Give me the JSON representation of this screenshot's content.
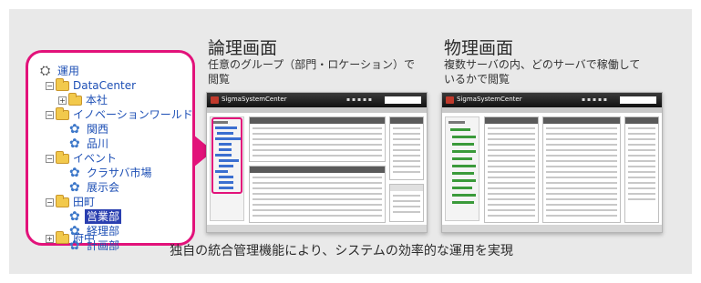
{
  "tree": {
    "items": [
      {
        "label": "運用",
        "type": "root"
      },
      {
        "label": "DataCenter",
        "type": "folder"
      },
      {
        "label": "本社",
        "type": "folder"
      },
      {
        "label": "イノベーションワールド",
        "type": "folder"
      },
      {
        "label": "関西",
        "type": "group"
      },
      {
        "label": "品川",
        "type": "group"
      },
      {
        "label": "イベント",
        "type": "folder"
      },
      {
        "label": "クラサバ市場",
        "type": "group"
      },
      {
        "label": "展示会",
        "type": "group"
      },
      {
        "label": "田町",
        "type": "folder"
      },
      {
        "label": "営業部",
        "type": "group",
        "selected": true
      },
      {
        "label": "経理部",
        "type": "group"
      },
      {
        "label": "計画部",
        "type": "group"
      },
      {
        "label": "府中",
        "type": "folder"
      }
    ]
  },
  "logical": {
    "title": "論理画面",
    "desc_line1": "任意のグループ（部門・ロケーション）で",
    "desc_line2": "閲覧"
  },
  "physical": {
    "title": "物理画面",
    "desc_line1": "複数サーバの内、どのサーバで稼働して",
    "desc_line2": "いるかで閲覧"
  },
  "shot_app_name": "SigmaSystemCenter",
  "caption": "独自の統合管理機能により、システムの効率的な運用を実現",
  "colors": {
    "accent": "#e2127a",
    "background": "#e9e9e9",
    "tree_link": "#1d4fb5",
    "selected_bg": "#2a3fb0"
  }
}
